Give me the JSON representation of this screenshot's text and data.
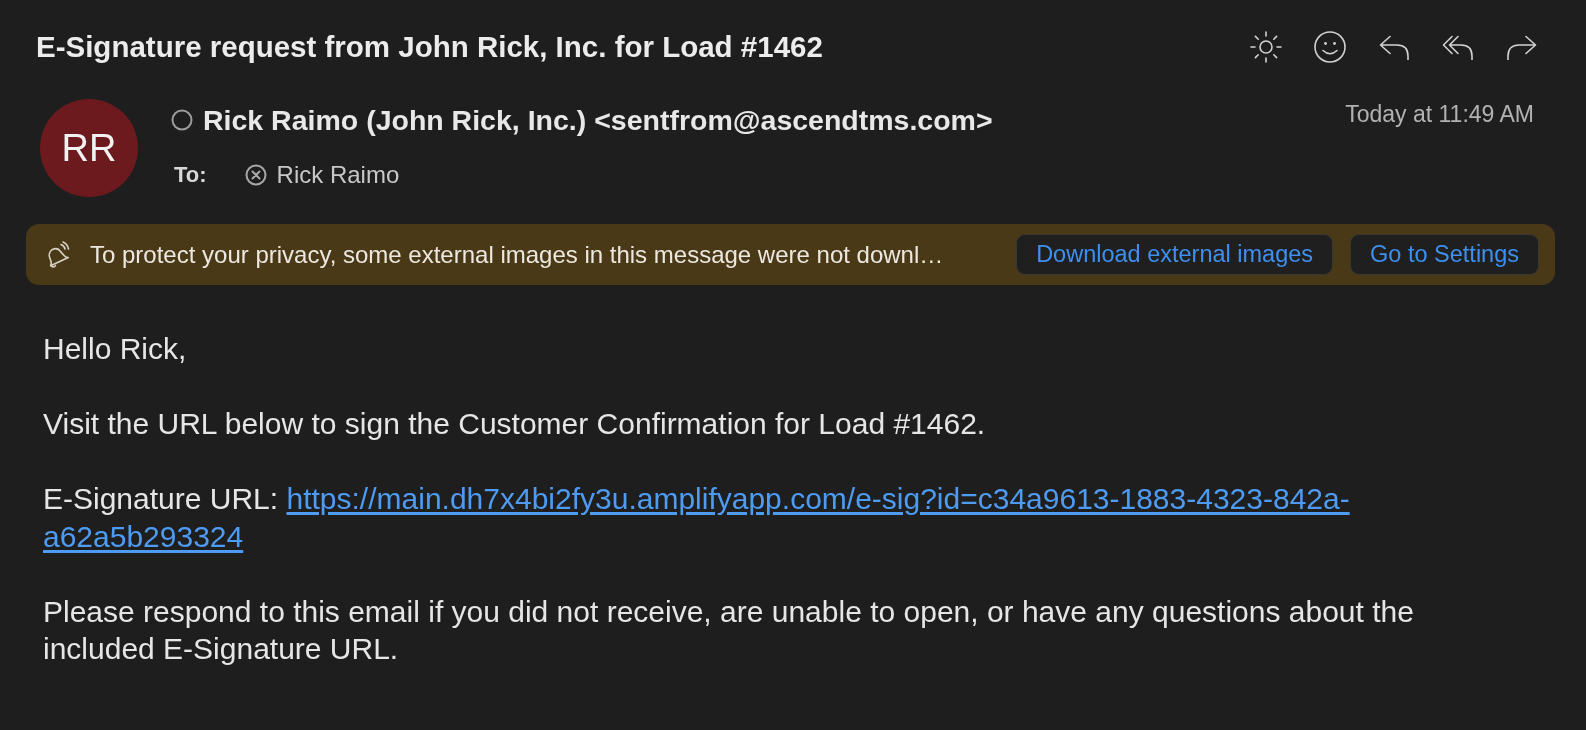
{
  "message": {
    "subject": "E-Signature request from John Rick, Inc. for Load #1462",
    "sender": {
      "initials": "RR",
      "name": "Rick Raimo (John Rick, Inc.) <sentfrom@ascendtms.com>",
      "date": "Today at 11:49 AM"
    },
    "to": {
      "label": "To:",
      "recipients": [
        "Rick Raimo"
      ]
    }
  },
  "privacy_banner": {
    "text": "To protect your privacy, some external images in this message were not downl…",
    "buttons": [
      "Download external images",
      "Go to Settings"
    ]
  },
  "body": [
    {
      "kind": "text",
      "text": "Hello Rick,"
    },
    {
      "kind": "text",
      "text": "Visit the URL below to sign the Customer Confirmation for Load #1462."
    },
    {
      "kind": "link",
      "label": "E-Signature URL:",
      "url_lines": [
        "https://main.dh7x4bi2fy3u.amplifyapp.com/e-sig?id=c34a9613-1883-4323-842a-",
        "a62a5b293324"
      ]
    },
    {
      "kind": "text",
      "text": "Please respond to this email if you did not receive, are unable to open, or have any questions about the included E-Signature URL."
    }
  ]
}
